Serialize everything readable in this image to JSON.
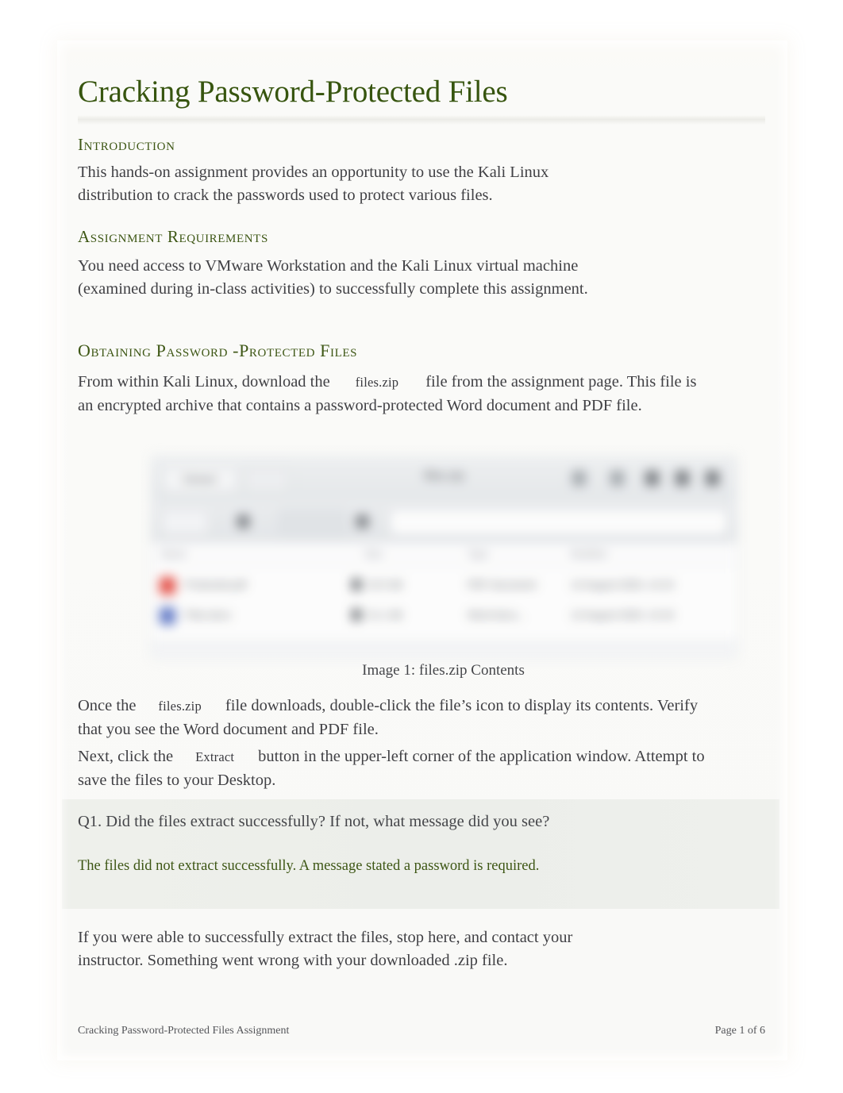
{
  "document": {
    "title": "Cracking Password-Protected Files"
  },
  "sections": {
    "intro": {
      "heading": "Introduction",
      "body": "This hands-on assignment provides an opportunity to use the Kali Linux distribution to crack the passwords used to protect various files."
    },
    "requirements": {
      "heading": "Assignment  Requirements",
      "body": "You need access to VMware Workstation and the Kali Linux virtual machine (examined during in-class activities) to successfully complete this assignment."
    },
    "obtaining": {
      "heading": "Obtaining  Password -Protected  Files",
      "para1_before": "From within Kali Linux, download the",
      "para1_code": "files.zip",
      "para1_after": "file from the assignment page. This file is an encrypted archive that contains a password-protected Word document and PDF file.",
      "para2_before": "Once the",
      "para2_code": "files.zip",
      "para2_after": "file downloads, double-click the file’s icon to display its contents. Verify that you see the Word document and PDF file.",
      "para3_before": "Next, click the",
      "para3_code": "Extract",
      "para3_after": "button in the upper-left corner of the application window. Attempt to save the files to your Desktop."
    }
  },
  "figure": {
    "caption": "Image 1: files.zip Contents",
    "window": {
      "toolbar": {
        "extract_button": "Extract",
        "nav_button": "",
        "title": "files.zip",
        "icons": [
          "search-icon",
          "menu-icon",
          "view-icon",
          "options-icon",
          "close-icon"
        ]
      },
      "pathbar": {
        "back_button": "",
        "location_chip": "files.zip",
        "path_field_value": ""
      },
      "columns": [
        "Name",
        "Size",
        "Type",
        "Modified"
      ],
      "rows": [
        {
          "icon": "pdf-file-icon",
          "name": "Protected.pdf",
          "size": "23.5 kB",
          "type": "PDF document",
          "modified": "12 August 2020, 14:15",
          "locked": true
        },
        {
          "icon": "word-file-icon",
          "name": "Files.docx",
          "size": "21.1 kB",
          "type": "Word docu...",
          "modified": "12 August 2020, 14:16",
          "locked": true
        }
      ]
    }
  },
  "question_block": {
    "question": "Q1. Did the files extract successfully? If not, what message did you see?",
    "answer": "The files did not extract successfully. A message stated a password is required."
  },
  "closing_paragraph": "If you were able to successfully extract the files, stop here, and contact your instructor. Something went wrong with your downloaded .zip file.",
  "footer": {
    "left": "Cracking Password-Protected Files Assignment",
    "right": "Page 1 of 6"
  },
  "colors": {
    "heading_green": "#3d5614",
    "title_green": "#37550f",
    "body_gray": "#414145",
    "answer_green": "#3d5614",
    "question_block_bg": "#eceeea",
    "page_bg": "#fbfaf7",
    "pdf_icon": "#e2453c",
    "word_icon": "#5b74c4"
  }
}
